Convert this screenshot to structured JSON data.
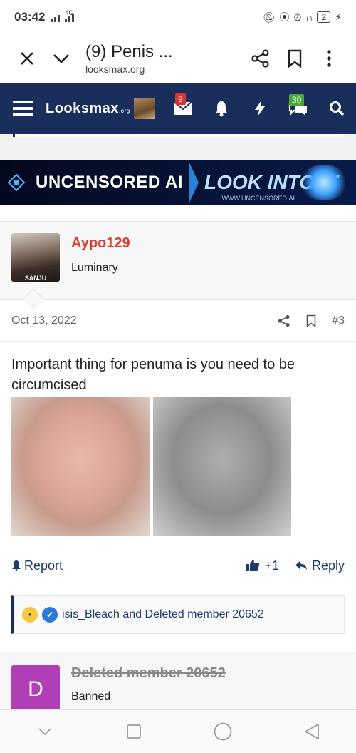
{
  "status_bar": {
    "time": "03:42",
    "network": "4G",
    "battery": "2"
  },
  "browser": {
    "page_title": "(9) Penis ...",
    "domain": "looksmax.org",
    "icons": [
      "close-icon",
      "chevron-down-icon",
      "share-icon",
      "bookmark-icon",
      "more-vertical-icon"
    ]
  },
  "site_nav": {
    "logo": "Looksmax",
    "logo_suffix": ".org",
    "inbox_badge": "9",
    "alerts_badge": "30",
    "icons": [
      "menu-icon",
      "inbox-icon",
      "bell-icon",
      "bolt-icon",
      "chat-icon",
      "search-icon"
    ]
  },
  "banner": {
    "left_text": "UNCENSORED AI",
    "right_text": "LOOK INTO IT",
    "url": "WWW.UNCENSORED.AI"
  },
  "post": {
    "username": "Aypo129",
    "user_title": "Luminary",
    "avatar_caption": "SANJU",
    "date": "Oct 13, 2022",
    "post_number": "#3",
    "body": "Important thing for penuma is you need to be circumcised",
    "actions": {
      "report": "Report",
      "like_count": "+1",
      "reply": "Reply"
    },
    "reactions_text": "isis_Bleach and Deleted member 20652"
  },
  "next_post": {
    "username": "Deleted member 20652",
    "user_title": "Banned",
    "avatar_letter": "D"
  },
  "colors": {
    "nav_bg": "#1a2e5c",
    "username": "#e03b2f",
    "link": "#1d3a6e",
    "deleted_avatar": "#b03fb5"
  }
}
